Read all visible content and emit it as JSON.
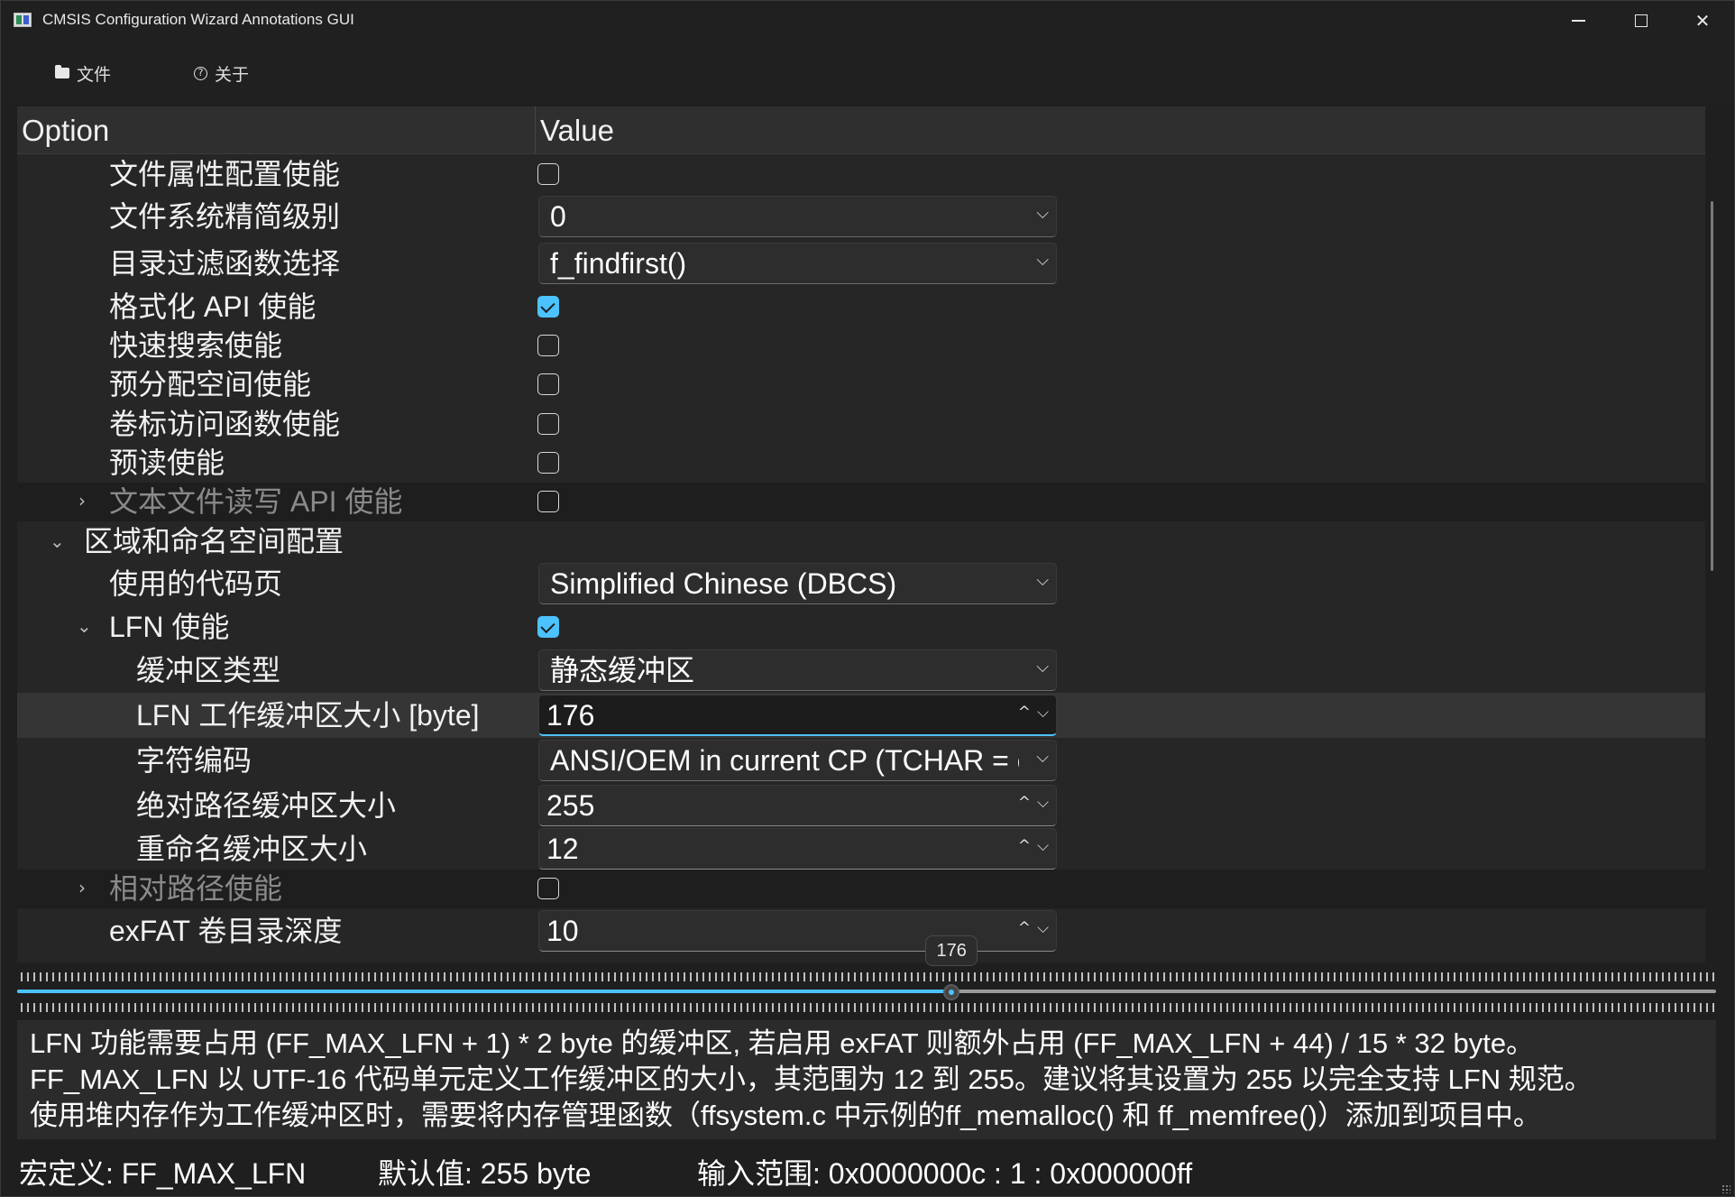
{
  "window": {
    "title": "CMSIS Configuration Wizard Annotations GUI"
  },
  "menu": {
    "file": "文件",
    "about": "关于"
  },
  "table": {
    "headers": {
      "option": "Option",
      "value": "Value"
    },
    "rows": [
      {
        "label": "文件属性配置使能",
        "type": "checkbox",
        "checked": false
      },
      {
        "label": "文件系统精简级别",
        "type": "select",
        "value": "0"
      },
      {
        "label": "目录过滤函数选择",
        "type": "select",
        "value": "f_findfirst()"
      },
      {
        "label": "格式化 API 使能",
        "type": "checkbox",
        "checked": true
      },
      {
        "label": "快速搜索使能",
        "type": "checkbox",
        "checked": false
      },
      {
        "label": "预分配空间使能",
        "type": "checkbox",
        "checked": false
      },
      {
        "label": "卷标访问函数使能",
        "type": "checkbox",
        "checked": false
      },
      {
        "label": "预读使能",
        "type": "checkbox",
        "checked": false
      },
      {
        "label": "文本文件读写 API 使能",
        "type": "checkbox",
        "checked": false,
        "collapsed": true,
        "disabled": true
      },
      {
        "label": "区域和命名空间配置",
        "type": "group",
        "expanded": true
      },
      {
        "label": "使用的代码页",
        "type": "select",
        "value": "Simplified Chinese (DBCS)"
      },
      {
        "label": "LFN 使能",
        "type": "checkbox",
        "checked": true,
        "expanded": true
      },
      {
        "label": "缓冲区类型",
        "type": "select",
        "value": "静态缓冲区"
      },
      {
        "label": "LFN 工作缓冲区大小 [byte]",
        "type": "spin",
        "value": "176",
        "selected": true
      },
      {
        "label": "字符编码",
        "type": "select",
        "value": "ANSI/OEM in current CP (TCHAR = char)"
      },
      {
        "label": "绝对路径缓冲区大小",
        "type": "spin",
        "value": "255"
      },
      {
        "label": "重命名缓冲区大小",
        "type": "spin",
        "value": "12"
      },
      {
        "label": "相对路径使能",
        "type": "checkbox",
        "checked": false,
        "collapsed": true,
        "disabled": true
      },
      {
        "label": "exFAT 卷目录深度",
        "type": "spin",
        "value": "10"
      }
    ]
  },
  "slider": {
    "value": "176",
    "min": 12,
    "max": 255,
    "fraction": 0.55
  },
  "description": {
    "line1": "LFN 功能需要占用 (FF_MAX_LFN + 1) * 2 byte 的缓冲区, 若启用 exFAT 则额外占用 (FF_MAX_LFN + 44) / 15 * 32 byte。",
    "line2": "FF_MAX_LFN 以 UTF-16 代码单元定义工作缓冲区的大小，其范围为 12 到 255。建议将其设置为 255 以完全支持 LFN 规范。",
    "line3": "使用堆内存作为工作缓冲区时，需要将内存管理函数（ffsystem.c 中示例的ff_memalloc() 和 ff_memfree()）添加到项目中。"
  },
  "status": {
    "macro": "宏定义: FF_MAX_LFN",
    "default": "默认值: 255 byte",
    "range": "输入范围: 0x0000000c : 1 : 0x000000ff"
  },
  "colors": {
    "accent": "#4cc2ff",
    "background": "#1f1f1f"
  }
}
